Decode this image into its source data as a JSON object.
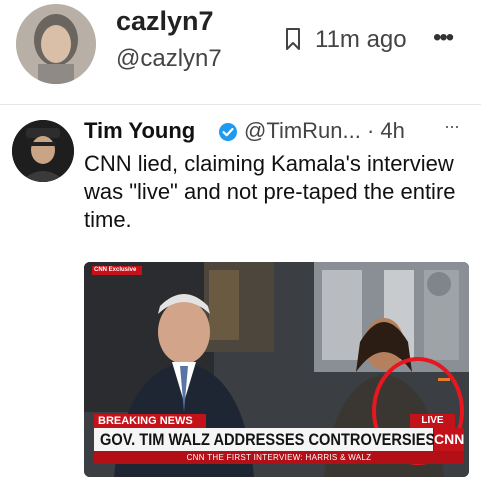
{
  "post": {
    "author_name": "cazlyn7",
    "author_handle": "@cazlyn7",
    "time_ago": "11m ago",
    "more_icon": "•••"
  },
  "embedded_tweet": {
    "author_name": "Tim Young",
    "author_handle": "@TimRun... · 4h",
    "more_icon": "···",
    "text": "CNN lied, claiming Kamala's interview was \"live\" and not pre-taped the entire time.",
    "video": {
      "exclusive_badge": "CNN Exclusive",
      "breaking_label": "BREAKING NEWS",
      "live_label": "LIVE",
      "headline": "GOV. TIM WALZ ADDRESSES CONTROVERSIES",
      "network_logo": "CNN",
      "ticker": "CNN THE FIRST INTERVIEW: HARRIS & WALZ"
    }
  },
  "colors": {
    "cnn_red": "#c4121a",
    "annotation_red": "#e8171f",
    "verified_blue": "#1d9bf0"
  }
}
